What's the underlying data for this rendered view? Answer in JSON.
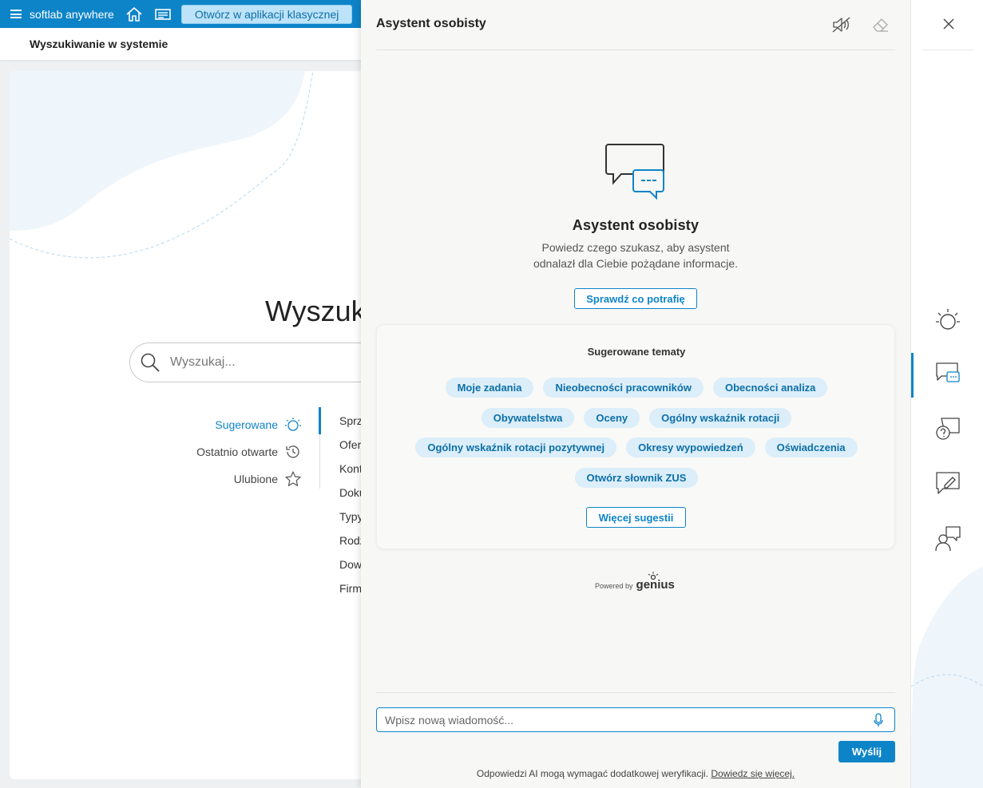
{
  "topbar": {
    "brand": "softlab anywhere",
    "home_icon": "home-icon",
    "news_icon": "newspaper-icon",
    "classic_button": "Otwórz w aplikacji klasycznej"
  },
  "subheader": {
    "title": "Wyszukiwanie w systemie"
  },
  "search": {
    "title": "Wyszukiwanie w systemie",
    "placeholder": "Wyszukaj...",
    "categories": [
      {
        "label": "Sugerowane",
        "icon": "lightbulb-icon",
        "active": true
      },
      {
        "label": "Ostatnio otwarte",
        "icon": "history-icon",
        "active": false
      },
      {
        "label": "Ulubione",
        "icon": "star-icon",
        "active": false
      }
    ],
    "subcategories": [
      "Sprz",
      "Ofer",
      "Kont",
      "Doku",
      "Typy",
      "Rodz",
      "Dow",
      "Firm"
    ]
  },
  "assistant": {
    "title": "Asystent osobisty",
    "mute_icon": "speaker-mute-icon",
    "clear_icon": "eraser-icon",
    "hero_icon": "chat-bubbles-icon",
    "hero_title": "Asystent osobisty",
    "hero_desc_line1": "Powiedz czego szukasz, aby asystent",
    "hero_desc_line2": "odnalazł dla Ciebie pożądane informacje.",
    "capabilities_button": "Sprawdź co potrafię",
    "topics_title": "Sugerowane tematy",
    "topics_rows": [
      [
        "Moje zadania",
        "Nieobecności pracowników",
        "Obecności analiza"
      ],
      [
        "Obywatelstwa",
        "Oceny",
        "Ogólny wskaźnik rotacji"
      ],
      [
        "Ogólny wskaźnik rotacji pozytywnej",
        "Okresy wypowiedzeń",
        "Oświadczenia"
      ],
      [
        "Otwórz słownik ZUS"
      ]
    ],
    "more_button": "Więcej sugestii",
    "powered_by": "Powered by",
    "powered_brand": "genius",
    "input_placeholder": "Wpisz nową wiadomość...",
    "mic_icon": "microphone-icon",
    "send_button": "Wyślij",
    "disclaimer": "Odpowiedzi AI mogą wymagać dodatkowej weryfikacji.",
    "disclaimer_link": "Dowiedz się więcej."
  },
  "rail": {
    "close_icon": "close-icon",
    "items": [
      "lightbulb-icon",
      "chat-icon",
      "help-chat-icon",
      "feedback-icon",
      "support-icon"
    ]
  },
  "colors": {
    "accent": "#0e84c8",
    "chip_bg": "#dbeef9",
    "topbar": "#0e84c8"
  }
}
